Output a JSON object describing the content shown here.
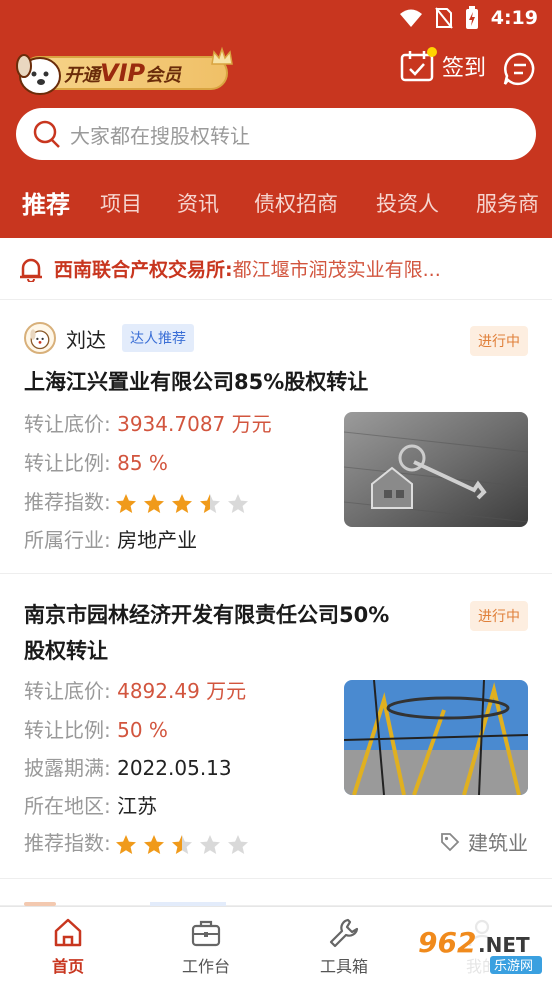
{
  "status": {
    "time": "4:19"
  },
  "header": {
    "vip_prefix": "开通",
    "vip_brand": "VIP",
    "vip_suffix": "会员",
    "signin_label": "签到"
  },
  "search": {
    "placeholder": "大家都在搜股权转让"
  },
  "tabs": [
    "推荐",
    "项目",
    "资讯",
    "债权招商",
    "投资人",
    "服务商"
  ],
  "notice": {
    "source": "西南联合产权交易所:",
    "text": "都江堰市润茂实业有限..."
  },
  "cards": [
    {
      "author": "刘达",
      "author_tag": "达人推荐",
      "status": "进行中",
      "title": "上海江兴置业有限公司85%股权转让",
      "rows": [
        {
          "label": "转让底价:",
          "value": "3934.7087 万元"
        },
        {
          "label": "转让比例:",
          "value": "85 %"
        },
        {
          "label": "推荐指数:",
          "rating": 3.5
        },
        {
          "label": "所属行业:",
          "value": "房地产业"
        }
      ]
    },
    {
      "status": "进行中",
      "title_line1": "南京市园林经济开发有限责任公司50%",
      "title_line2": "股权转让",
      "rows": [
        {
          "label": "转让底价:",
          "value": "4892.49 万元"
        },
        {
          "label": "转让比例:",
          "value": "50 %"
        },
        {
          "label": "披露期满:",
          "value": "2022.05.13"
        },
        {
          "label": "所在地区:",
          "value": "江苏"
        },
        {
          "label": "推荐指数:",
          "rating": 2.5
        }
      ],
      "industry": "建筑业"
    }
  ],
  "bottom_nav": [
    {
      "label": "首页",
      "icon": "home-icon",
      "active": true
    },
    {
      "label": "工作台",
      "icon": "briefcase-icon",
      "active": false
    },
    {
      "label": "工具箱",
      "icon": "wrench-icon",
      "active": false
    },
    {
      "label": "我的",
      "icon": "person-icon",
      "active": false
    }
  ],
  "watermark": {
    "text": "962.NET",
    "sub": "乐游网"
  },
  "colors": {
    "brand_red": "#c8361f",
    "accent_red": "#d2553e",
    "tag_orange": "#e0803a",
    "star_orange": "#f09a1a"
  }
}
